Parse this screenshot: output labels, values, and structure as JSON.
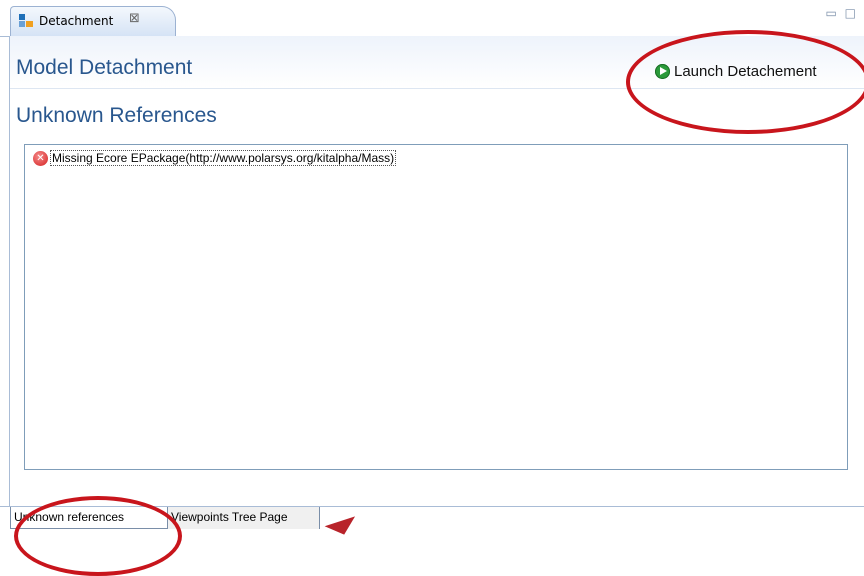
{
  "editor_tab": {
    "label": "Detachment",
    "close_glyph": "⊠"
  },
  "window_controls": {
    "minimize_glyph": "▭",
    "maximize_glyph": "□"
  },
  "header": {
    "title": "Model Detachment",
    "launch_label": "Launch Detachement"
  },
  "section": {
    "title": "Unknown References"
  },
  "references": [
    {
      "status": "error",
      "icon": "error-icon",
      "text": "Missing Ecore EPackage(http://www.polarsys.org/kitalpha/Mass)"
    }
  ],
  "page_tabs": [
    {
      "label": "Unknown references",
      "active": true
    },
    {
      "label": "Viewpoints Tree Page",
      "active": false
    }
  ],
  "colors": {
    "title": "#29578e",
    "annotation": "#c8151c",
    "run": "#2a9a3a",
    "error": "#d42020"
  }
}
